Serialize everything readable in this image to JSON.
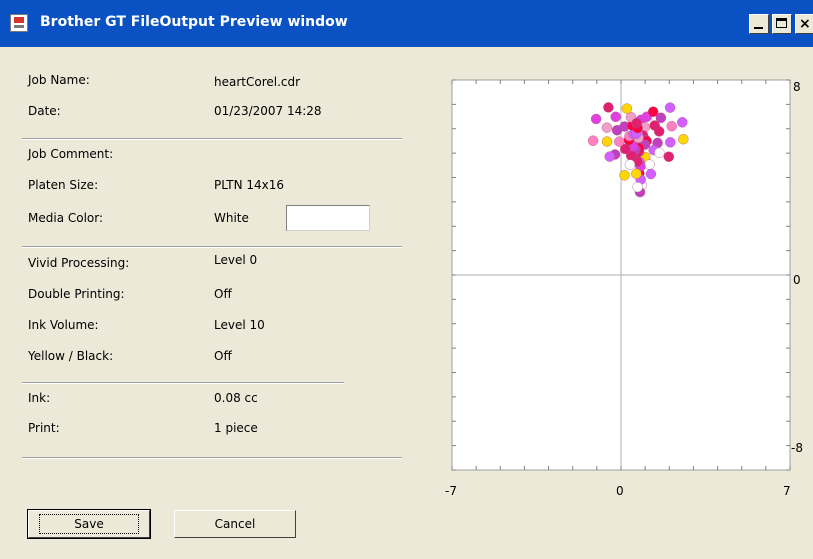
{
  "window": {
    "title": "Brother GT FileOutput Preview window",
    "close_glyph": "×"
  },
  "fields": {
    "job_name": {
      "label": "Job Name:",
      "value": "heartCorel.cdr"
    },
    "date": {
      "label": "Date:",
      "value": "01/23/2007 14:28"
    },
    "job_comment": {
      "label": "Job Comment:",
      "value": ""
    },
    "platen_size": {
      "label": "Platen Size:",
      "value": "PLTN 14x16"
    },
    "media_color": {
      "label": "Media Color:",
      "value": "White",
      "swatch": "#ffffff"
    },
    "vivid_processing": {
      "label": "Vivid Processing:",
      "value": "Level 0"
    },
    "double_printing": {
      "label": "Double Printing:",
      "value": "Off"
    },
    "ink_volume": {
      "label": "Ink Volume:",
      "value": "Level 10"
    },
    "yellow_black": {
      "label": "Yellow / Black:",
      "value": "Off"
    },
    "ink": {
      "label": "Ink:",
      "value": "0.08 cc"
    },
    "print": {
      "label": "Print:",
      "value": "1 piece"
    }
  },
  "buttons": {
    "save": "Save",
    "cancel": "Cancel"
  },
  "preview": {
    "x_ticks": [
      "-7",
      "0",
      "7"
    ],
    "y_ticks": [
      "8",
      "0",
      "-8"
    ],
    "x_range": [
      -7,
      7
    ],
    "y_range": [
      -8,
      8
    ],
    "image": "heart made of colored circles",
    "palette": [
      "#e040e0",
      "#ff80c0",
      "#f0a0c8",
      "#e02070",
      "#c040c0",
      "#ff0040",
      "#ffd700",
      "#ffffff",
      "#d060ff"
    ]
  }
}
